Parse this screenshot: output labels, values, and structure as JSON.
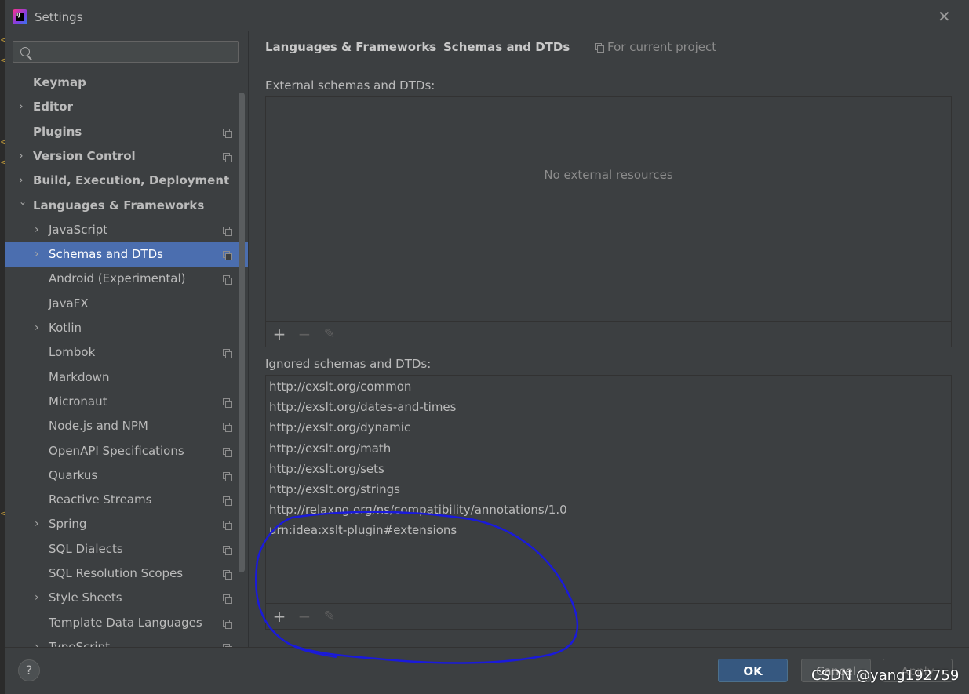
{
  "window": {
    "title": "Settings"
  },
  "sidebar": {
    "search": {
      "placeholder": ""
    },
    "items": [
      {
        "label": "Keymap",
        "bold": true,
        "indent": 0,
        "expander": "none",
        "project_icon": false,
        "selected": false
      },
      {
        "label": "Editor",
        "bold": true,
        "indent": 0,
        "expander": "collapsed",
        "project_icon": false,
        "selected": false
      },
      {
        "label": "Plugins",
        "bold": true,
        "indent": 0,
        "expander": "none",
        "project_icon": true,
        "selected": false
      },
      {
        "label": "Version Control",
        "bold": true,
        "indent": 0,
        "expander": "collapsed",
        "project_icon": true,
        "selected": false
      },
      {
        "label": "Build, Execution, Deployment",
        "bold": true,
        "indent": 0,
        "expander": "collapsed",
        "project_icon": false,
        "selected": false
      },
      {
        "label": "Languages & Frameworks",
        "bold": true,
        "indent": 0,
        "expander": "expanded",
        "project_icon": false,
        "selected": false
      },
      {
        "label": "JavaScript",
        "bold": false,
        "indent": 1,
        "expander": "collapsed",
        "project_icon": true,
        "selected": false
      },
      {
        "label": "Schemas and DTDs",
        "bold": false,
        "indent": 1,
        "expander": "collapsed",
        "project_icon": true,
        "selected": true
      },
      {
        "label": "Android (Experimental)",
        "bold": false,
        "indent": 1,
        "expander": "none",
        "project_icon": true,
        "selected": false
      },
      {
        "label": "JavaFX",
        "bold": false,
        "indent": 1,
        "expander": "none",
        "project_icon": false,
        "selected": false
      },
      {
        "label": "Kotlin",
        "bold": false,
        "indent": 1,
        "expander": "collapsed",
        "project_icon": false,
        "selected": false
      },
      {
        "label": "Lombok",
        "bold": false,
        "indent": 1,
        "expander": "none",
        "project_icon": true,
        "selected": false
      },
      {
        "label": "Markdown",
        "bold": false,
        "indent": 1,
        "expander": "none",
        "project_icon": false,
        "selected": false
      },
      {
        "label": "Micronaut",
        "bold": false,
        "indent": 1,
        "expander": "none",
        "project_icon": true,
        "selected": false
      },
      {
        "label": "Node.js and NPM",
        "bold": false,
        "indent": 1,
        "expander": "none",
        "project_icon": true,
        "selected": false
      },
      {
        "label": "OpenAPI Specifications",
        "bold": false,
        "indent": 1,
        "expander": "none",
        "project_icon": true,
        "selected": false
      },
      {
        "label": "Quarkus",
        "bold": false,
        "indent": 1,
        "expander": "none",
        "project_icon": true,
        "selected": false
      },
      {
        "label": "Reactive Streams",
        "bold": false,
        "indent": 1,
        "expander": "none",
        "project_icon": true,
        "selected": false
      },
      {
        "label": "Spring",
        "bold": false,
        "indent": 1,
        "expander": "collapsed",
        "project_icon": true,
        "selected": false
      },
      {
        "label": "SQL Dialects",
        "bold": false,
        "indent": 1,
        "expander": "none",
        "project_icon": true,
        "selected": false
      },
      {
        "label": "SQL Resolution Scopes",
        "bold": false,
        "indent": 1,
        "expander": "none",
        "project_icon": true,
        "selected": false
      },
      {
        "label": "Style Sheets",
        "bold": false,
        "indent": 1,
        "expander": "collapsed",
        "project_icon": true,
        "selected": false
      },
      {
        "label": "Template Data Languages",
        "bold": false,
        "indent": 1,
        "expander": "none",
        "project_icon": true,
        "selected": false
      },
      {
        "label": "TypeScript",
        "bold": false,
        "indent": 1,
        "expander": "collapsed",
        "project_icon": true,
        "selected": false
      }
    ]
  },
  "breadcrumb": {
    "parent": "Languages & Frameworks",
    "separator": "›",
    "current": "Schemas and DTDs",
    "scope": "For current project"
  },
  "external": {
    "label": "External schemas and DTDs:",
    "empty_text": "No external resources"
  },
  "ignored": {
    "label": "Ignored schemas and DTDs:",
    "urls": [
      "http://exslt.org/common",
      "http://exslt.org/dates-and-times",
      "http://exslt.org/dynamic",
      "http://exslt.org/math",
      "http://exslt.org/sets",
      "http://exslt.org/strings",
      "http://relaxng.org/ns/compatibility/annotations/1.0",
      "urn:idea:xslt-plugin#extensions"
    ]
  },
  "toolbar": {
    "add": "+",
    "remove": "−",
    "edit": "✎"
  },
  "footer": {
    "help": "?",
    "ok": "OK",
    "cancel": "Cancel",
    "apply": "Apply"
  },
  "watermark": "CSDN @yang192759",
  "colors": {
    "selection": "#4b6eaf",
    "ok_button": "#365880",
    "annotation": "#1a1adb",
    "background": "#3c3f41"
  },
  "icons": {
    "close": "close-icon",
    "search": "search-icon",
    "project_scope": "copy-icon",
    "help": "help-icon"
  }
}
